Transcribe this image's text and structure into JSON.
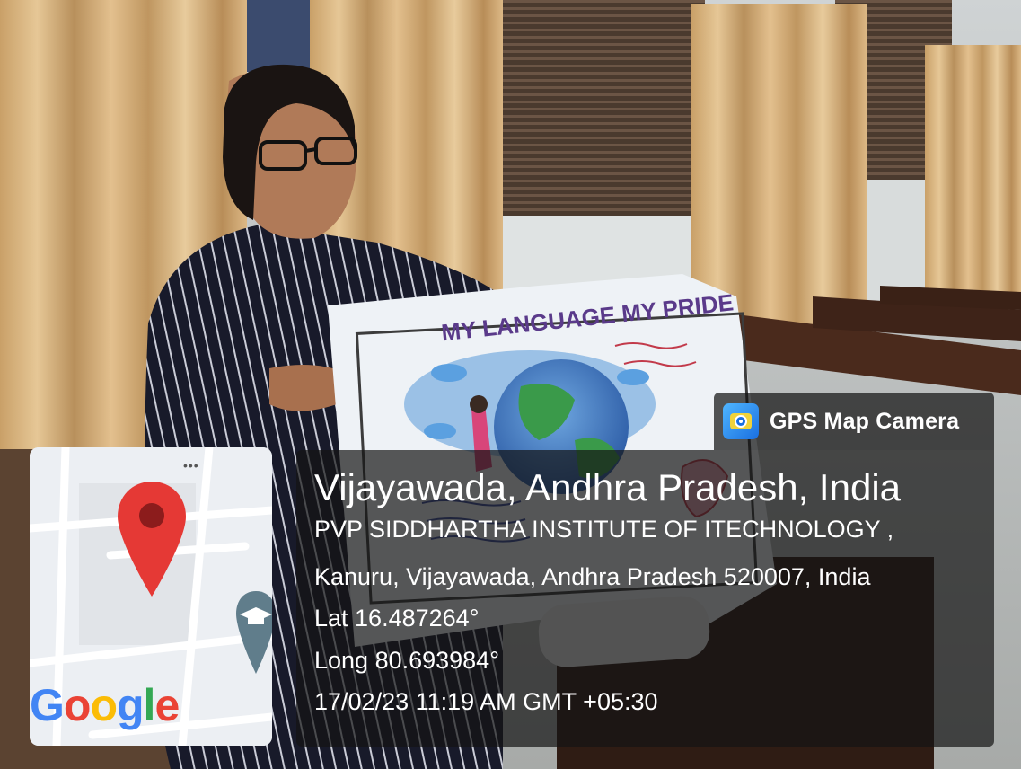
{
  "poster": {
    "title": "MY LANGUAGE MY PRIDE"
  },
  "overlay": {
    "app_name": "GPS Map Camera",
    "location_title": "Vijayawada, Andhra Pradesh, India",
    "address_line1": "PVP SIDDHARTHA INSTITUTE OF ITECHNOLOGY ,",
    "address_line2": "Kanuru, Vijayawada, Andhra Pradesh 520007, India",
    "latitude": "Lat 16.487264°",
    "longitude": "Long 80.693984°",
    "timestamp": "17/02/23 11:19 AM GMT +05:30"
  },
  "map": {
    "brand": {
      "letters": [
        {
          "char": "G",
          "color": "#4285F4"
        },
        {
          "char": "o",
          "color": "#EA4335"
        },
        {
          "char": "o",
          "color": "#FBBC05"
        },
        {
          "char": "g",
          "color": "#4285F4"
        },
        {
          "char": "l",
          "color": "#34A853"
        },
        {
          "char": "e",
          "color": "#EA4335"
        }
      ]
    },
    "menu_icon": "more-dots-icon",
    "pin_icon": "location-pin-icon",
    "school_icon": "graduation-cap-icon",
    "dots": "•••"
  },
  "colors": {
    "pin": "#E53935",
    "school_pin": "#607D8B",
    "panel": "rgba(20,20,20,0.70)"
  }
}
